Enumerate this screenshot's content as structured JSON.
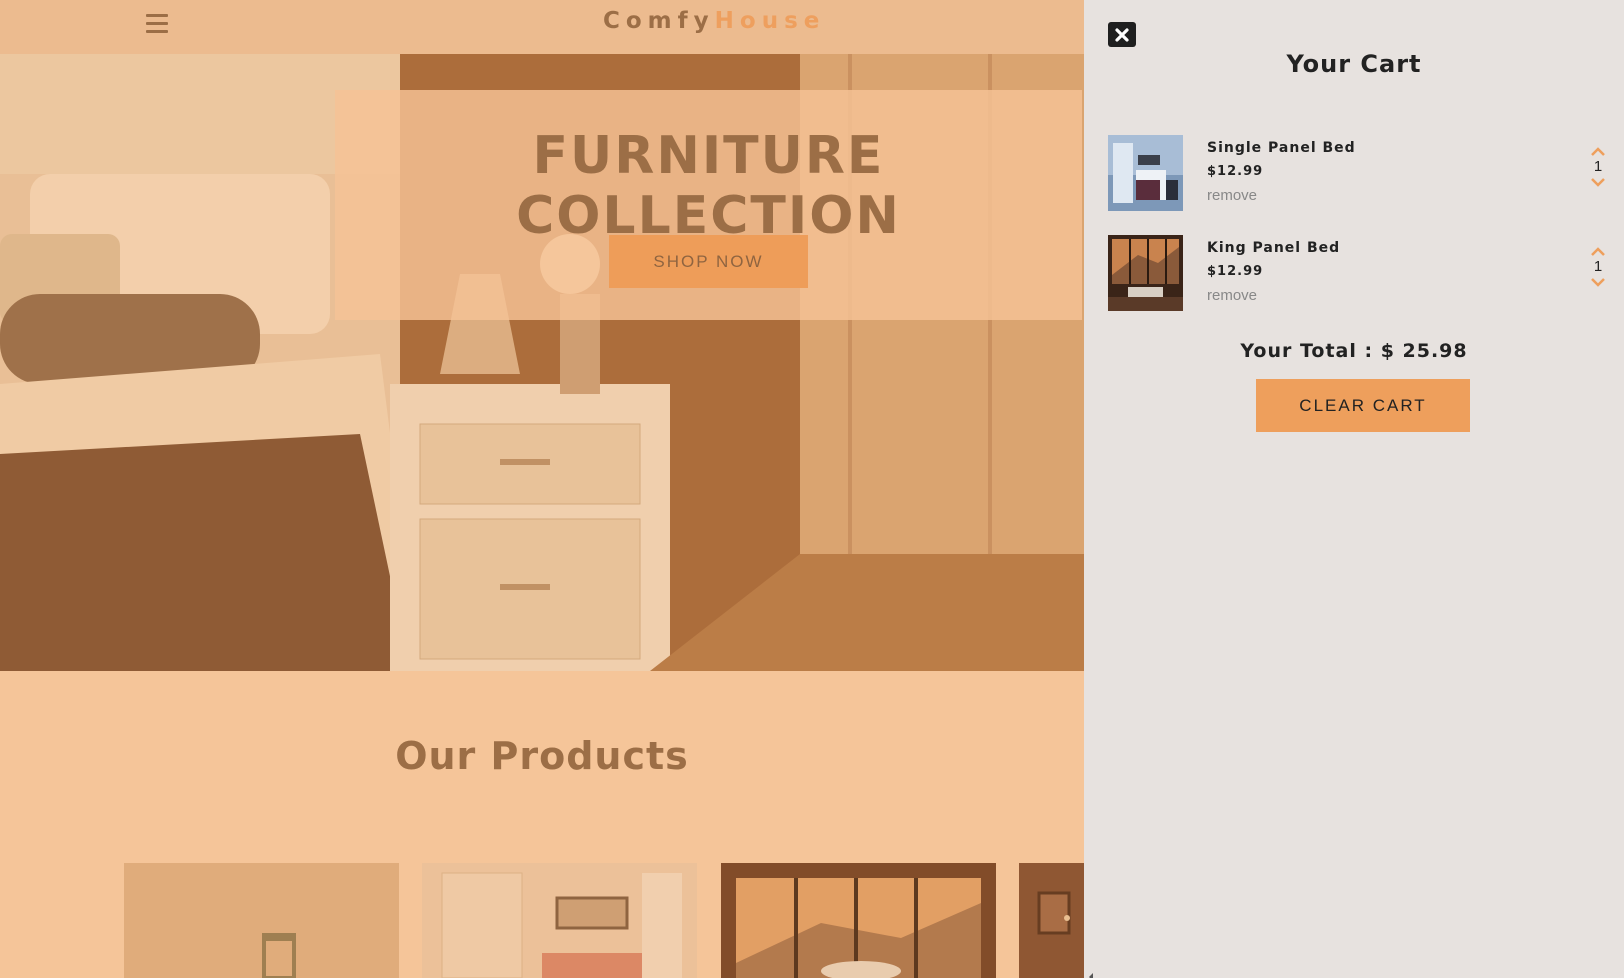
{
  "navbar": {
    "logo_part1": "Comfy",
    "logo_part2": "House",
    "menu_icon": "hamburger-icon"
  },
  "hero": {
    "title": "FURNITURE COLLECTION",
    "button_label": "SHOP NOW"
  },
  "products": {
    "title": "Our Products"
  },
  "cart": {
    "title": "Your Cart",
    "close_icon": "close-icon",
    "items": [
      {
        "name": "Single Panel Bed",
        "price": "$12.99",
        "remove_label": "remove",
        "quantity": "1"
      },
      {
        "name": "King Panel Bed",
        "price": "$12.99",
        "remove_label": "remove",
        "quantity": "1"
      }
    ],
    "total_label": "Your Total : $ 25.98",
    "clear_label": "CLEAR CART"
  },
  "colors": {
    "accent": "#ee9f5c",
    "brand_dark": "#8a6645",
    "cart_bg": "#e7e2df",
    "page_bg": "#f7d0aa"
  }
}
